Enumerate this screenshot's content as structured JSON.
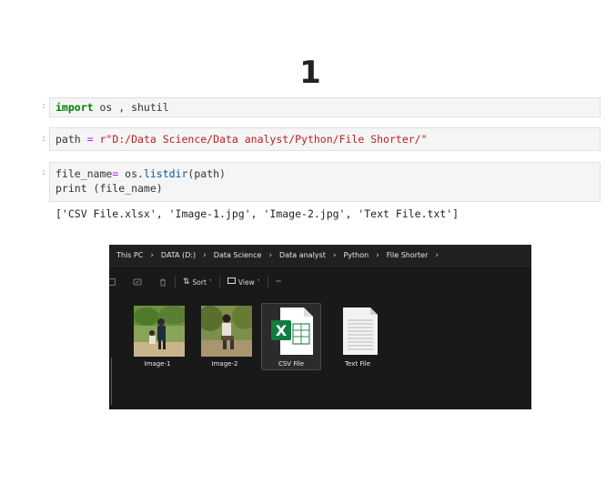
{
  "heading": {
    "number": "1"
  },
  "notebook": {
    "prompt": ":",
    "cell1": {
      "keyword": "import",
      "rest": " os , shutil"
    },
    "cell2": {
      "var": "path",
      "op": " = ",
      "value": "r\"D:/Data Science/Data analyst/Python/File Shorter/\""
    },
    "cell3": {
      "line1_var": "file_name",
      "line1_op": "=",
      "line1_mid": " os.",
      "line1_fn": "listdir",
      "line1_end": "(path)",
      "line2": "print (file_name)"
    },
    "output": "['CSV File.xlsx', 'Image-1.jpg', 'Image-2.jpg', 'Text File.txt']"
  },
  "explorer": {
    "breadcrumb": [
      "This PC",
      "DATA (D:)",
      "Data Science",
      "Data analyst",
      "Python",
      "File Shorter"
    ],
    "breadcrumb_sep": "›",
    "toolbar": {
      "sort": "Sort",
      "view": "View",
      "more": "···"
    },
    "files": [
      {
        "name": "Image-1",
        "icon": "photo-thumbnail"
      },
      {
        "name": "Image-2",
        "icon": "photo-thumbnail"
      },
      {
        "name": "CSV File",
        "icon": "excel-file-icon",
        "selected": true
      },
      {
        "name": "Text File",
        "icon": "text-file-icon"
      }
    ],
    "colors": {
      "background": "#191919",
      "excel_green": "#107c41"
    }
  }
}
